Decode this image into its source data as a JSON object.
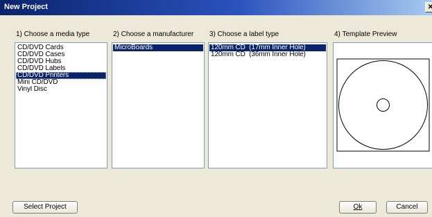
{
  "window": {
    "title": "New Project",
    "close_glyph": "✕"
  },
  "sections": {
    "media_type": {
      "label": "1) Choose a media type",
      "items": [
        "CD/DVD Cards",
        "CD/DVD Cases",
        "CD/DVD Hubs",
        "CD/DVD Labels",
        "CD/DVD Printers",
        "Mini CD/DVD",
        "Vinyl Disc"
      ],
      "selected": "CD/DVD Printers"
    },
    "manufacturer": {
      "label": "2) Choose a manufacturer",
      "items": [
        "MicroBoards"
      ],
      "selected": "MicroBoards"
    },
    "label_type": {
      "label": "3) Choose a label type",
      "items": [
        "120mm CD  (17mm Inner Hole)",
        "120mm CD  (36mm Inner Hole)"
      ],
      "selected": "120mm CD  (17mm Inner Hole)"
    },
    "preview": {
      "label": "4) Template Preview"
    }
  },
  "buttons": {
    "select_project": "Select Project",
    "ok": "Ok",
    "cancel": "Cancel"
  },
  "colors": {
    "selection": "#0a246a",
    "dialog_bg": "#ece9d8",
    "title_bar": "#0a246a"
  }
}
